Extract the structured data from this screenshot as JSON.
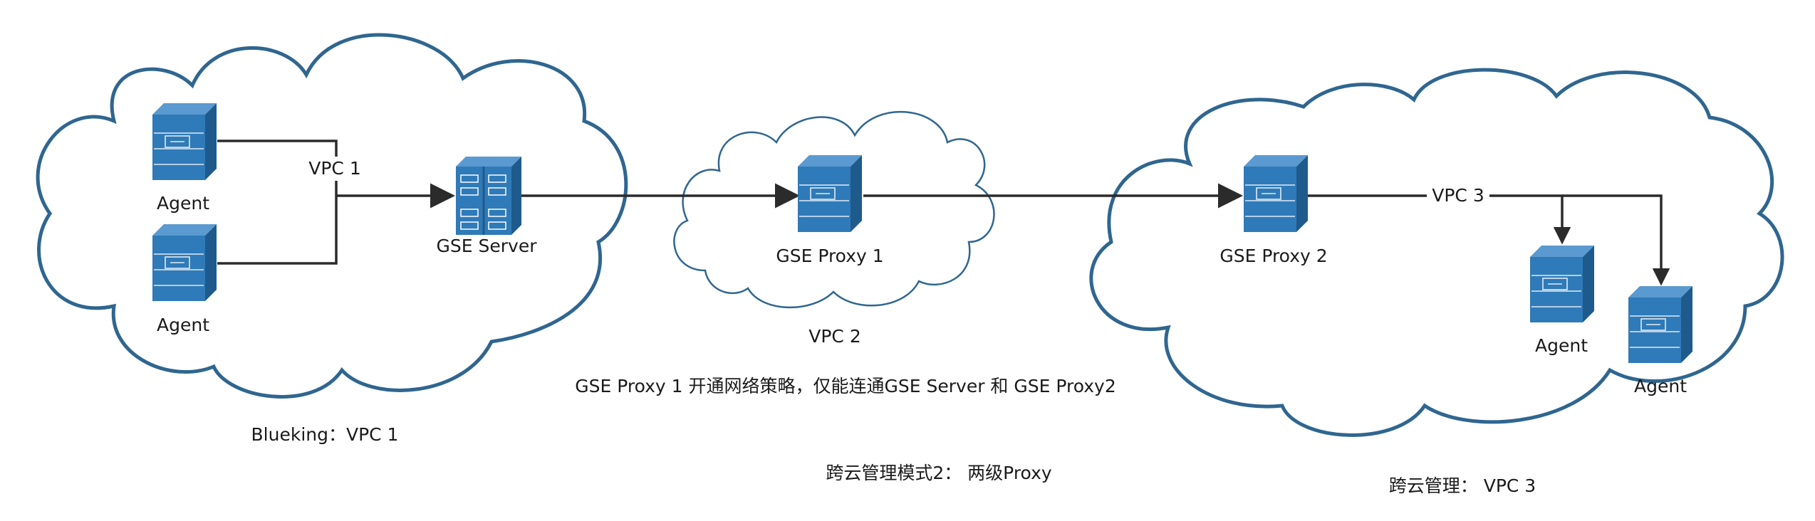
{
  "labels": {
    "agent_a": "Agent",
    "agent_b": "Agent",
    "vpc1_link": "VPC 1",
    "gse_server": "GSE Server",
    "gse_proxy1": "GSE Proxy 1",
    "vpc2": "VPC 2",
    "gse_proxy2": "GSE Proxy 2",
    "vpc3_link": "VPC 3",
    "agent_c": "Agent",
    "agent_d": "Agent",
    "note": "GSE Proxy 1 开通网络策略，仅能连通GSE Server 和 GSE Proxy2",
    "caption_left": "Blueking：VPC 1",
    "caption_mid": "跨云管理模式2：  两级Proxy",
    "caption_right": "跨云管理：  VPC 3"
  },
  "colors": {
    "cloud_stroke": "#2f6690",
    "server": "#2f7ab8",
    "line": "#2b2b2b"
  }
}
